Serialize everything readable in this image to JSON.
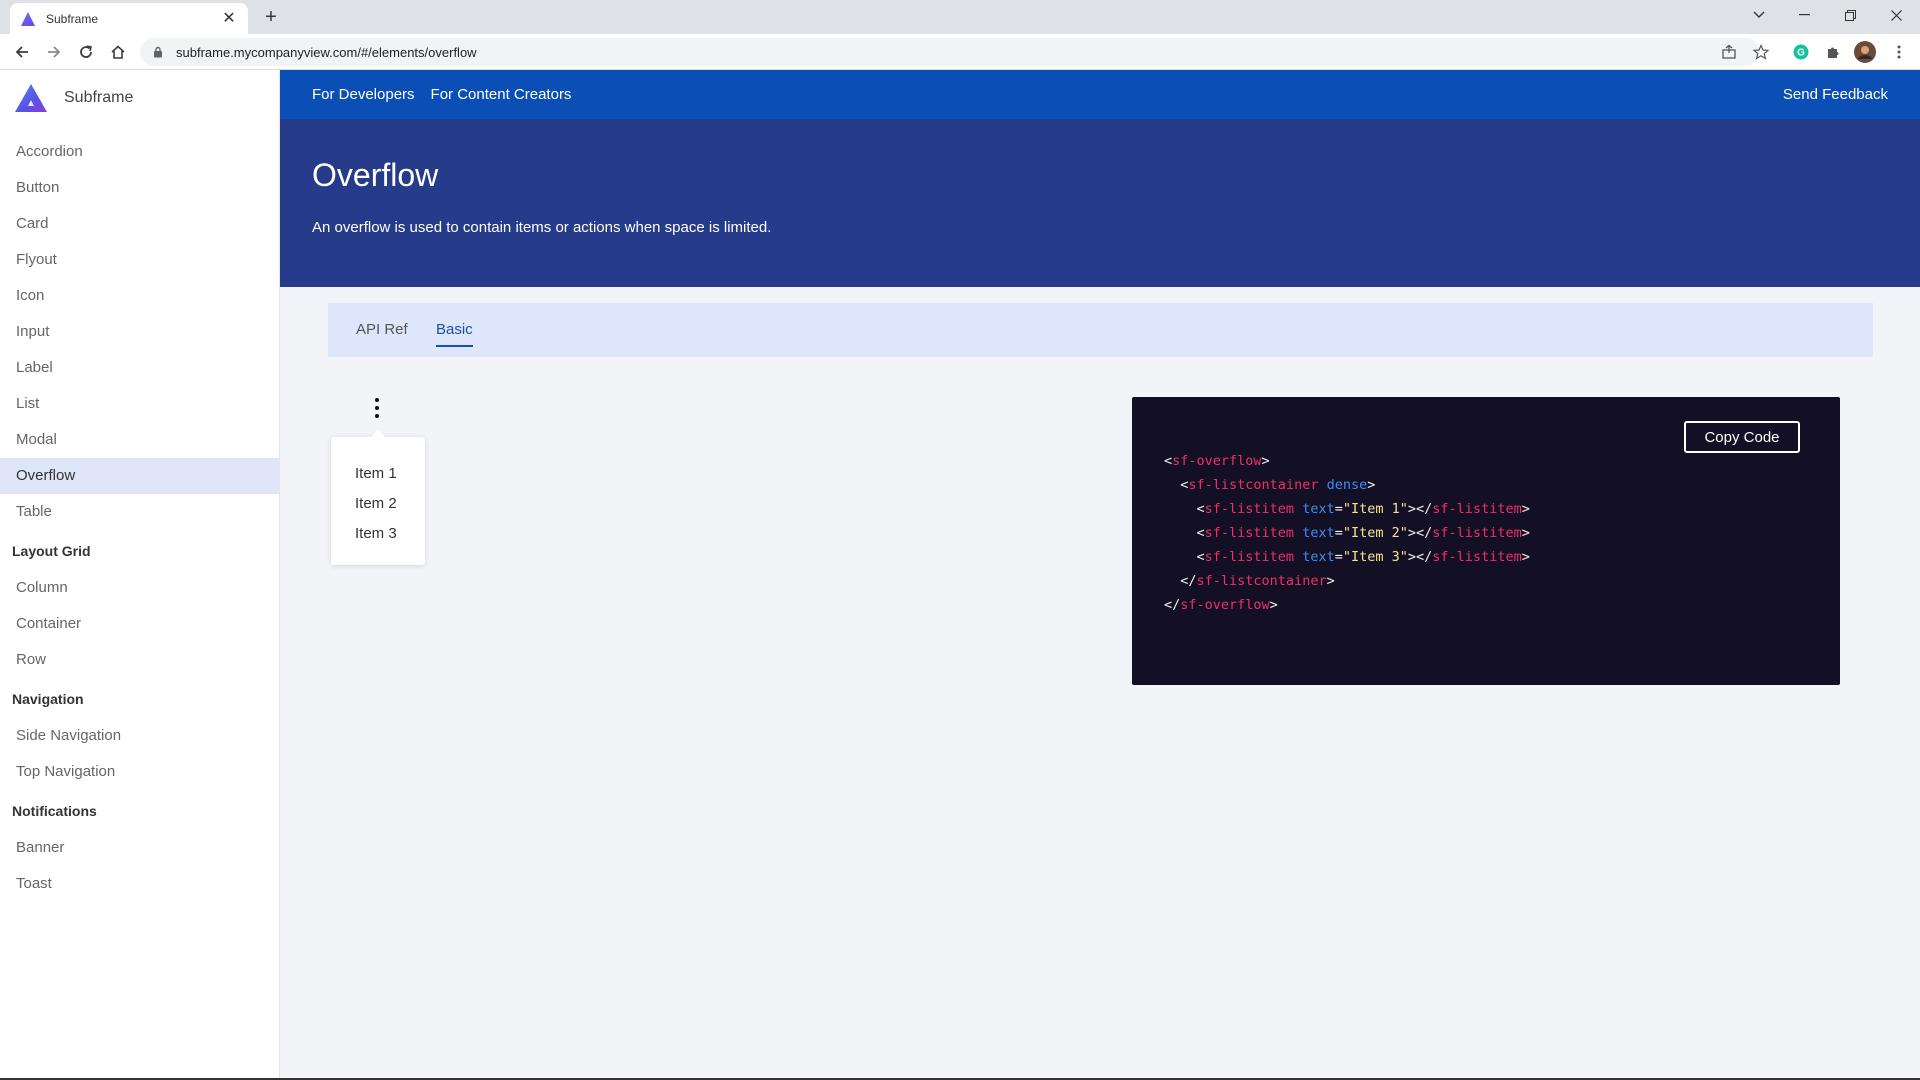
{
  "browser": {
    "tab_title": "Subframe",
    "url": "subframe.mycompanyview.com/#/elements/overflow"
  },
  "brand": {
    "name": "Subframe"
  },
  "sidebar": {
    "items": [
      "Accordion",
      "Button",
      "Card",
      "Flyout",
      "Icon",
      "Input",
      "Label",
      "List",
      "Modal",
      "Overflow",
      "Table"
    ],
    "active": "Overflow",
    "sections": [
      {
        "title": "Layout Grid",
        "items": [
          "Column",
          "Container",
          "Row"
        ]
      },
      {
        "title": "Navigation",
        "items": [
          "Side Navigation",
          "Top Navigation"
        ]
      },
      {
        "title": "Notifications",
        "items": [
          "Banner",
          "Toast"
        ]
      }
    ]
  },
  "topnav": {
    "links": [
      "For Developers",
      "For Content Creators"
    ],
    "feedback": "Send Feedback"
  },
  "hero": {
    "title": "Overflow",
    "description": "An overflow is used to contain items or actions when space is limited."
  },
  "tabs": [
    "API Ref",
    "Basic"
  ],
  "tabs_active": "Basic",
  "demo": {
    "menu_items": [
      "Item 1",
      "Item 2",
      "Item 3"
    ]
  },
  "code": {
    "copy_label": "Copy Code",
    "lines": [
      "<sf-overflow>",
      "  <sf-listcontainer dense>",
      "    <sf-listitem text=\"Item 1\"></sf-listitem>",
      "    <sf-listitem text=\"Item 2\"></sf-listitem>",
      "    <sf-listitem text=\"Item 3\"></sf-listitem>",
      "  </sf-listcontainer>",
      "</sf-overflow>"
    ]
  },
  "colors": {
    "topnav": "#0b4fb6",
    "hero": "#263b8a",
    "accent": "#1a4fb0",
    "code_bg": "#130f25",
    "code_tag": "#ef2f6b",
    "code_attr": "#3d8df5",
    "code_string": "#f5e58a"
  }
}
